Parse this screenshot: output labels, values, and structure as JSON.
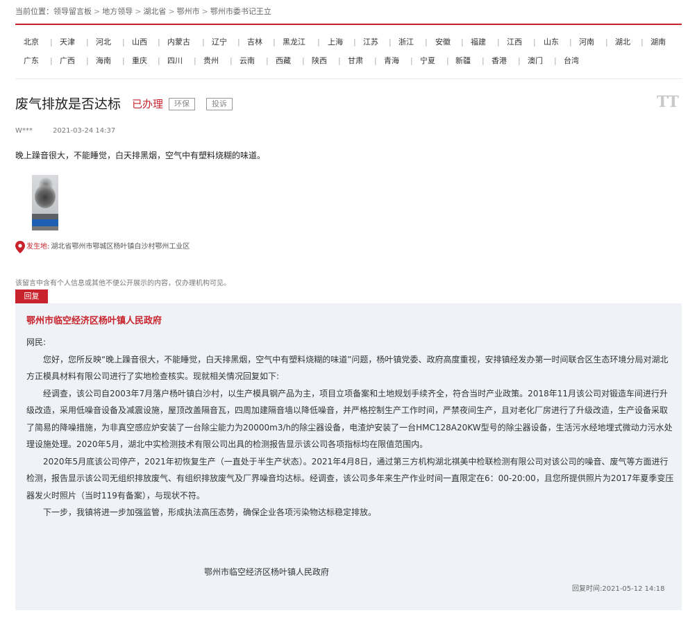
{
  "breadcrumb": {
    "prefix": "当前位置：",
    "items": [
      "领导留言板",
      "地方领导",
      "湖北省",
      "鄂州市",
      "鄂州市委书记王立"
    ],
    "separator": ">"
  },
  "provinces": {
    "row1": [
      "北京",
      "天津",
      "河北",
      "山西",
      "内蒙古",
      "辽宁",
      "吉林",
      "黑龙江",
      "上海",
      "江苏",
      "浙江",
      "安徽",
      "福建",
      "江西",
      "山东",
      "河南",
      "湖北",
      "湖南"
    ],
    "row2": [
      "广东",
      "广西",
      "海南",
      "重庆",
      "四川",
      "贵州",
      "云南",
      "西藏",
      "陕西",
      "甘肃",
      "青海",
      "宁夏",
      "新疆",
      "香港",
      "澳门",
      "台湾"
    ]
  },
  "message": {
    "title": "废气排放是否达标",
    "status": "已办理",
    "tags": [
      "环保",
      "投诉"
    ],
    "font_toggle": "TT",
    "author": "W***",
    "date": "2021-03-24 14:37",
    "content": "晚上躁音很大，不能睡觉，白天排黑烟，空气中有塑料烧糊的味道。",
    "location_label": "发生地:",
    "location_value": "湖北省鄂州市鄂城区杨叶镇白沙村鄂州工业区"
  },
  "privacy_note": "该留言中含有个人信息或其他不便公开展示的内容，仅办理机构可见。",
  "reply": {
    "tab_label": "回复",
    "org": "鄂州市临空经济区杨叶镇人民政府",
    "salutation": "网民:",
    "paragraphs": [
      "您好，您所反映“晚上躁音很大，不能睡觉，白天排黑烟，空气中有塑料烧糊的味道”问题，杨叶镇党委、政府高度重视，安排镇经发办第一时间联合区生态环境分局对湖北方正模具材料有限公司进行了实地检查核实。现就相关情况回复如下:",
      "经调查，该公司自2003年7月落户杨叶镇白沙村，以生产模具钢产品为主，项目立项备案和土地规划手续齐全，符合当时产业政策。2018年11月该公司对锻造车间进行升级改造，采用低噪音设备及减震设施，屋顶改盖隔音瓦，四周加建隔音墙以降低噪音，并严格控制生产工作时间，严禁夜间生产，且对老化厂房进行了升级改造，生产设备采取了简易的降噪措施，为非真空感应炉安装了一台除尘能力为20000m3/h的除尘器设备，电渣炉安装了一台HMC128A20KW型号的除尘器设备，生活污水经地埋式微动力污水处理设施处理。2020年5月，湖北中实检测技术有限公司出具的检测报告显示该公司各项指标均在限值范围内。",
      "2020年5月底该公司停产，2021年初恢复生产（一直处于半生产状态）。2021年4月8日，通过第三方机构湖北祺美中检联检测有限公司对该公司的噪音、废气等方面进行检测，报告显示该公司无组织排放废气、有组织排放废气及厂界噪音均达标。经调查，该公司多年来生产作业时间一直限定在6：00-20:00，且您所提供照片为2017年夏季变压器发火时照片（当时119有备案），与现状不符。",
      "下一步，我镇将进一步加强监管，形成执法高压态势，确保企业各项污染物达标稳定排放。"
    ],
    "signature": "鄂州市临空经济区杨叶镇人民政府",
    "time_label": "回复时间:",
    "time_value": "2021-05-12 14:18"
  },
  "colors": {
    "accent": "#c8232c",
    "reply_bg": "#eff2f7"
  },
  "icons": {
    "location": "location-pin-icon",
    "font_size": "font-size-toggle-icon"
  }
}
